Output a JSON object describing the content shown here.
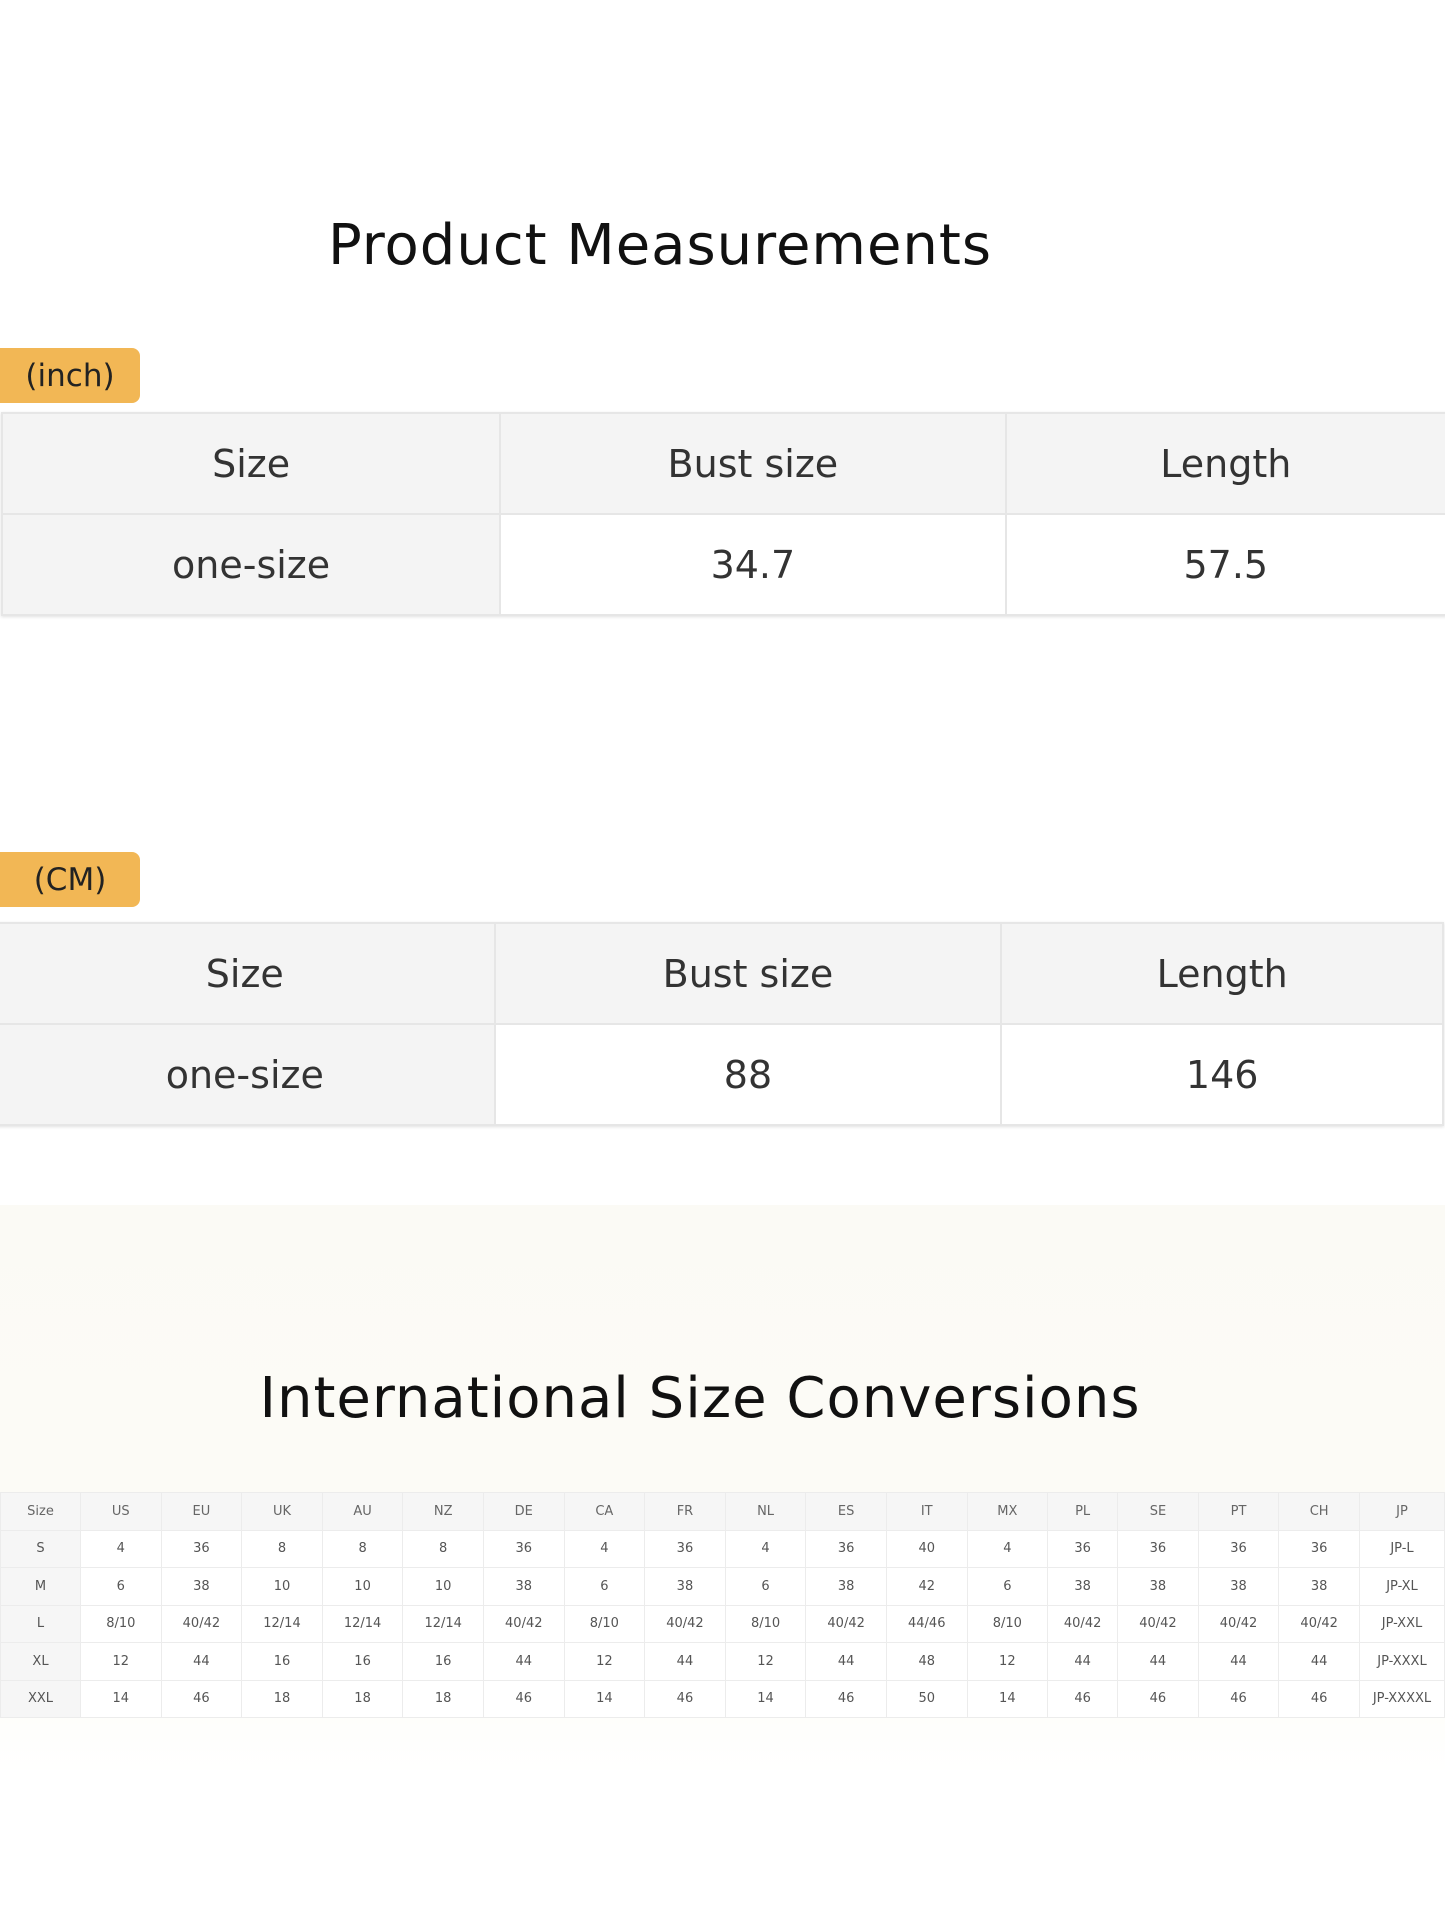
{
  "product_measurements": {
    "title": "Product Measurements",
    "inch": {
      "unit_label": "(inch)",
      "headers": [
        "Size",
        "Bust size",
        "Length"
      ],
      "row": [
        "one-size",
        "34.7",
        "57.5"
      ]
    },
    "cm": {
      "unit_label": "(CM)",
      "headers": [
        "Size",
        "Bust size",
        "Length"
      ],
      "row": [
        "one-size",
        "88",
        "146"
      ]
    }
  },
  "size_conversions": {
    "title": "International Size Conversions",
    "headers": [
      "Size",
      "US",
      "EU",
      "UK",
      "AU",
      "NZ",
      "DE",
      "CA",
      "FR",
      "NL",
      "ES",
      "IT",
      "MX",
      "PL",
      "SE",
      "PT",
      "CH",
      "JP"
    ],
    "rows": [
      [
        "S",
        "4",
        "36",
        "8",
        "8",
        "8",
        "36",
        "4",
        "36",
        "4",
        "36",
        "40",
        "4",
        "36",
        "36",
        "36",
        "36",
        "JP-L"
      ],
      [
        "M",
        "6",
        "38",
        "10",
        "10",
        "10",
        "38",
        "6",
        "38",
        "6",
        "38",
        "42",
        "6",
        "38",
        "38",
        "38",
        "38",
        "JP-XL"
      ],
      [
        "L",
        "8/10",
        "40/42",
        "12/14",
        "12/14",
        "12/14",
        "40/42",
        "8/10",
        "40/42",
        "8/10",
        "40/42",
        "44/46",
        "8/10",
        "40/42",
        "40/42",
        "40/42",
        "40/42",
        "JP-XXL"
      ],
      [
        "XL",
        "12",
        "44",
        "16",
        "16",
        "16",
        "44",
        "12",
        "44",
        "12",
        "44",
        "48",
        "12",
        "44",
        "44",
        "44",
        "44",
        "JP-XXXL"
      ],
      [
        "XXL",
        "14",
        "46",
        "18",
        "18",
        "18",
        "46",
        "14",
        "46",
        "14",
        "46",
        "50",
        "14",
        "46",
        "46",
        "46",
        "46",
        "JP-XXXXL"
      ]
    ]
  },
  "colors": {
    "unit_tag_background": "#f2b755",
    "header_cell_background": "#f4f4f4"
  }
}
